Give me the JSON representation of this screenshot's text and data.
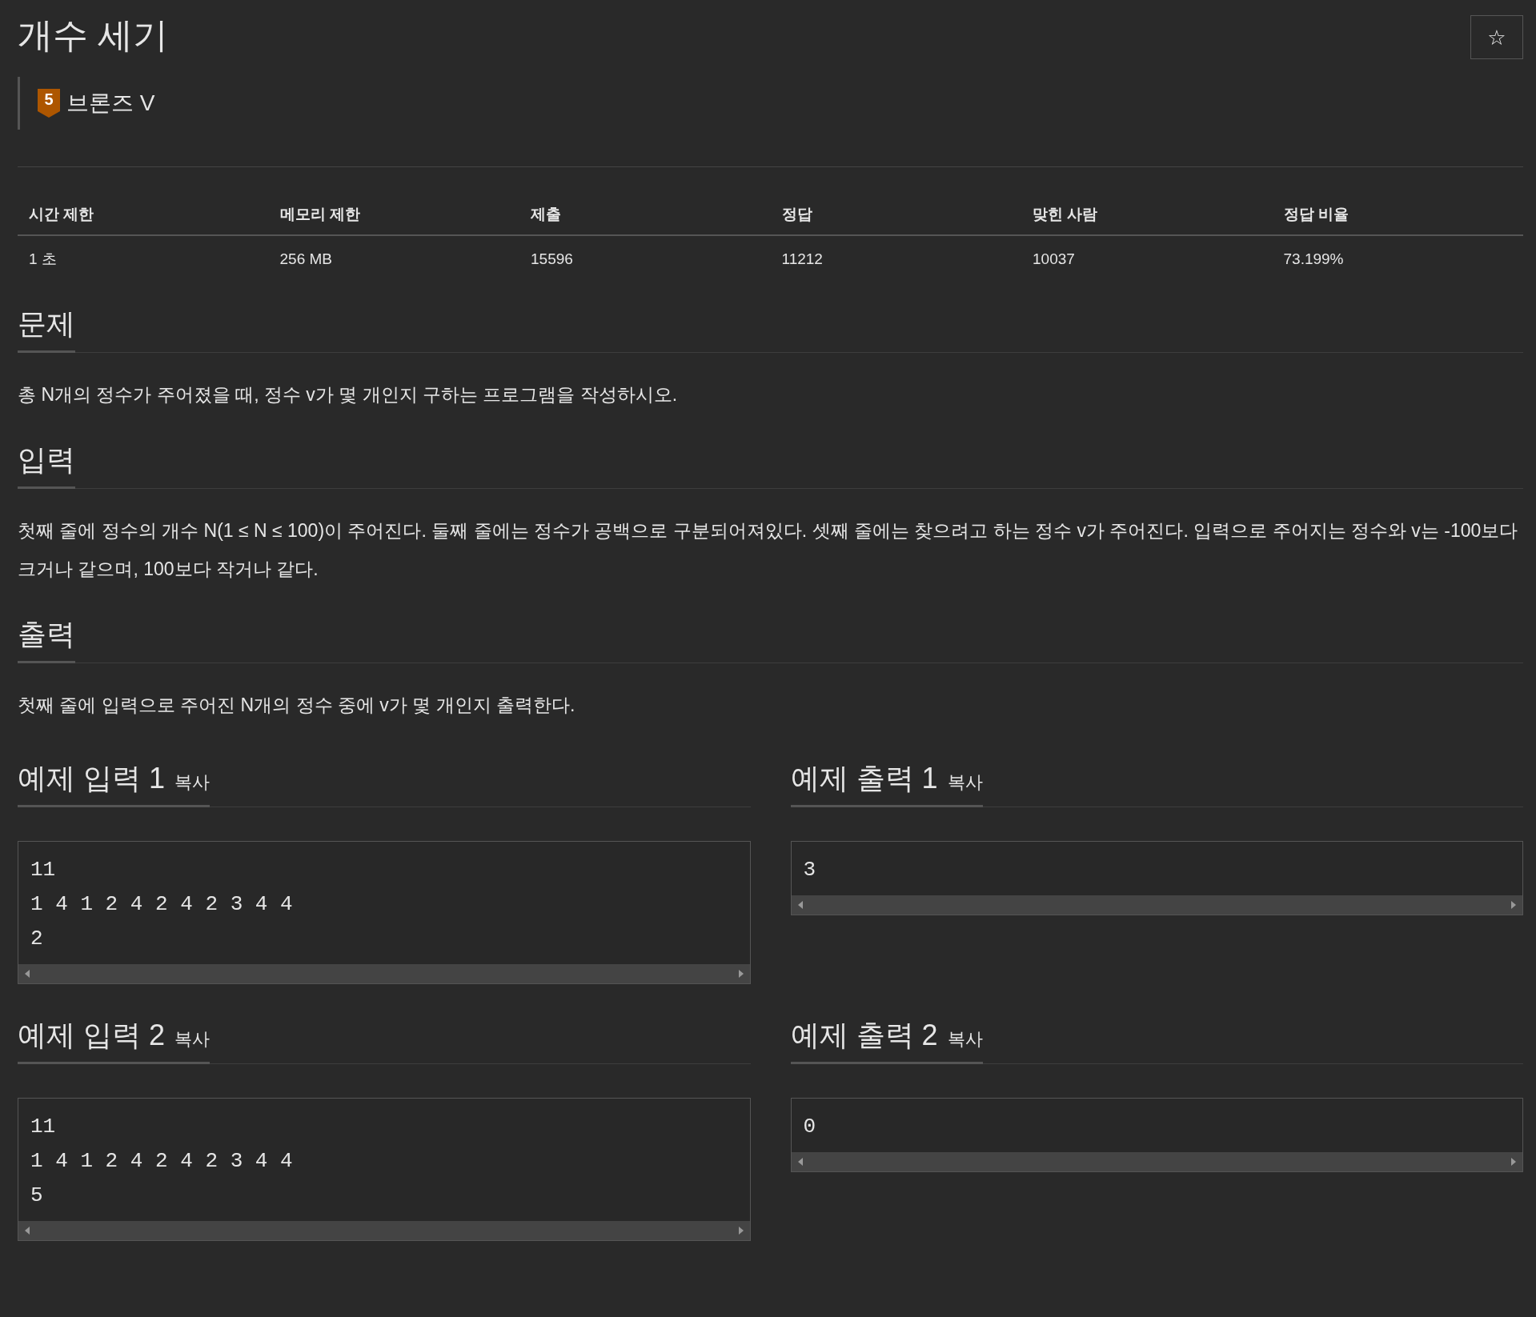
{
  "title": "개수 세기",
  "star_button": "☆",
  "tier": {
    "number": "5",
    "name": "브론즈 V"
  },
  "info_table": {
    "columns": [
      "시간 제한",
      "메모리 제한",
      "제출",
      "정답",
      "맞힌 사람",
      "정답 비율"
    ],
    "rows": [
      [
        "1 초",
        "256 MB",
        "15596",
        "11212",
        "10037",
        "73.199%"
      ]
    ]
  },
  "sections": [
    {
      "heading": "문제",
      "paragraphs": [
        "총 N개의 정수가 주어졌을 때, 정수 v가 몇 개인지 구하는 프로그램을 작성하시오."
      ]
    },
    {
      "heading": "입력",
      "paragraphs": [
        "첫째 줄에 정수의 개수 N(1 ≤ N ≤ 100)이 주어진다. 둘째 줄에는 정수가 공백으로 구분되어져있다. 셋째 줄에는 찾으려고 하는 정수 v가 주어진다. 입력으로 주어지는 정수와 v는 -100보다 크거나 같으며, 100보다 작거나 같다."
      ]
    },
    {
      "heading": "출력",
      "paragraphs": [
        "첫째 줄에 입력으로 주어진 N개의 정수 중에 v가 몇 개인지 출력한다."
      ]
    }
  ],
  "samples": [
    {
      "title": "예제 입력 1",
      "copy": "복사",
      "lines": [
        "11",
        "1 4 1 2 4 2 4 2 3 4 4",
        "2"
      ]
    },
    {
      "title": "예제 출력 1",
      "copy": "복사",
      "lines": [
        "3"
      ]
    },
    {
      "title": "예제 입력 2",
      "copy": "복사",
      "lines": [
        "11",
        "1 4 1 2 4 2 4 2 3 4 4",
        "5"
      ]
    },
    {
      "title": "예제 출력 2",
      "copy": "복사",
      "lines": [
        "0"
      ]
    }
  ]
}
